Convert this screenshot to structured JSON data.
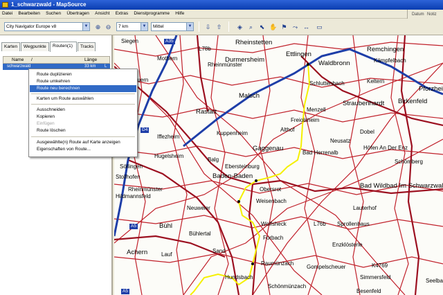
{
  "window": {
    "title": "1_schwarzwald - MapSource"
  },
  "menu": [
    "Datei",
    "Bearbeiten",
    "Suchen",
    "Übertragen",
    "Ansicht",
    "Extras",
    "Dienstprogramme",
    "Hilfe"
  ],
  "right_strip": {
    "datum": "Datum",
    "notiz": "Notiz"
  },
  "toolbar": {
    "map_product": "City Navigator Europe v8",
    "zoom_level": "7 km",
    "detail_level": "Mittel"
  },
  "tabs": [
    {
      "label": "Karten",
      "active": false
    },
    {
      "label": "Wegpunkte",
      "active": false
    },
    {
      "label": "Routen(1)",
      "active": true
    },
    {
      "label": "Tracks",
      "active": false
    }
  ],
  "list": {
    "columns": {
      "name": "Name",
      "sort": "/",
      "length": "Länge"
    },
    "row": {
      "name": "schwarzwald",
      "length": "33 km",
      "flag": "L"
    }
  },
  "context_menu": {
    "items": [
      {
        "label": "Route duplizieren",
        "state": "normal"
      },
      {
        "label": "Route umkehren",
        "state": "normal"
      },
      {
        "label": "Route neu berechnen",
        "state": "selected"
      },
      {
        "label": "Karten um Route auswählen",
        "state": "normal"
      },
      {
        "label": "Ausschneiden",
        "state": "normal"
      },
      {
        "label": "Kopieren",
        "state": "normal"
      },
      {
        "label": "Einfügen",
        "state": "disabled"
      },
      {
        "label": "Route löschen",
        "state": "normal"
      },
      {
        "label": "Ausgewählte(n) Route auf Karte anzeigen",
        "state": "normal"
      },
      {
        "label": "Eigenschaften von Route...",
        "state": "normal"
      }
    ]
  },
  "map": {
    "road_labels": [
      "A35",
      "A5",
      "A5",
      "D4"
    ],
    "places": [
      "Siegen",
      "Mothern",
      "L78b",
      "Rheinstetten",
      "Ettlingen",
      "Rheinmünster",
      "Remchingen",
      "Kämpfelbach",
      "Durmersheim",
      "Waldbronn",
      "Malsch",
      "Schluttenbach",
      "Keltern",
      "Pforzheim",
      "Birkenfeld",
      "Rastatt",
      "Menzell",
      "Straubenhardt",
      "Freiolsheim",
      "Althof",
      "Neusatz",
      "Kuppenheim",
      "Gaggenau",
      "Bad Herrenalb",
      "Dobel",
      "Höfen An Der Enz",
      "Schömberg",
      "Balg",
      "Ebersteinburg",
      "Baden-Baden",
      "Obersrot",
      "Weisenbach",
      "Bad Wildbad Im Schwarzwald",
      "Steinmauern",
      "Iffezheim",
      "Hugelsheim",
      "Söllingen",
      "Stollhofen",
      "Hildmannsfeld",
      "Rheinmünster",
      "Neuweier",
      "Bühl",
      "Bühlertal",
      "Wolfsheck",
      "L76b",
      "Sprollenhaus",
      "Lauterhof",
      "Forbach",
      "Enzklösterle",
      "Sand",
      "Raumünzach",
      "Gompelscheuer",
      "Simmersfeld",
      "Hundsbach",
      "Schönmünzach",
      "Achern",
      "Lauf",
      "Seelbach",
      "K4769",
      "Besenfeld"
    ]
  },
  "colors": {
    "route": "#f5f000",
    "highway": "#1e3ea8",
    "major_road": "#9c1020",
    "minor_road": "#c0202a",
    "selection": "#316ac5"
  }
}
